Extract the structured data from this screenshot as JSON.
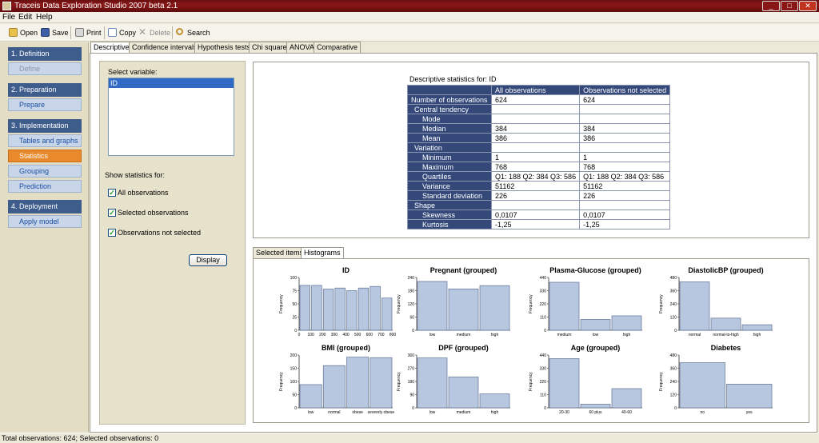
{
  "window": {
    "title": "Traceis Data Exploration Studio 2007 beta 2.1",
    "min": "_",
    "max": "□",
    "close": "✕"
  },
  "menu": [
    "File",
    "Edit",
    "Help"
  ],
  "toolbar": {
    "open": "Open",
    "save": "Save",
    "print": "Print",
    "copy": "Copy",
    "delete": "Delete",
    "search": "Search"
  },
  "sidebar": {
    "sections": [
      {
        "label": "1. Definition",
        "items": [
          {
            "label": "Define",
            "state": "disabled"
          }
        ]
      },
      {
        "label": "2. Preparation",
        "items": [
          {
            "label": "Prepare",
            "state": "normal"
          }
        ]
      },
      {
        "label": "3. Implementation",
        "items": [
          {
            "label": "Tables and graphs",
            "state": "normal"
          },
          {
            "label": "Statistics",
            "state": "active"
          },
          {
            "label": "Grouping",
            "state": "normal"
          },
          {
            "label": "Prediction",
            "state": "normal"
          }
        ]
      },
      {
        "label": "4. Deployment",
        "items": [
          {
            "label": "Apply model",
            "state": "normal"
          }
        ]
      }
    ]
  },
  "tabs": [
    "Descriptive",
    "Confidence intervals",
    "Hypothesis tests",
    "Chi square",
    "ANOVA",
    "Comparative"
  ],
  "options": {
    "select_label": "Select variable:",
    "selected_variable": "ID",
    "show_label": "Show statistics for:",
    "checks": [
      {
        "label": "All observations",
        "checked": true
      },
      {
        "label": "Selected observations",
        "checked": true
      },
      {
        "label": "Observations not selected",
        "checked": true
      }
    ],
    "display_button": "Display"
  },
  "stats": {
    "title": "Descriptive statistics for: ID",
    "columns": [
      "",
      "All observations",
      "Observations not selected"
    ],
    "rows": [
      {
        "label": "Number of observations",
        "indent": 0,
        "a": "624",
        "b": "624"
      },
      {
        "label": "Central tendency",
        "indent": 1,
        "a": "",
        "b": ""
      },
      {
        "label": "Mode",
        "indent": 2,
        "a": "",
        "b": ""
      },
      {
        "label": "Median",
        "indent": 2,
        "a": "384",
        "b": "384"
      },
      {
        "label": "Mean",
        "indent": 2,
        "a": "386",
        "b": "386"
      },
      {
        "label": "Variation",
        "indent": 1,
        "a": "",
        "b": ""
      },
      {
        "label": "Minimum",
        "indent": 2,
        "a": "1",
        "b": "1"
      },
      {
        "label": "Maximum",
        "indent": 2,
        "a": "768",
        "b": "768"
      },
      {
        "label": "Quartiles",
        "indent": 2,
        "a": "Q1: 188 Q2: 384 Q3: 586",
        "b": "Q1: 188 Q2: 384 Q3: 586"
      },
      {
        "label": "Variance",
        "indent": 2,
        "a": "51162",
        "b": "51162"
      },
      {
        "label": "Standard deviation",
        "indent": 2,
        "a": "226",
        "b": "226"
      },
      {
        "label": "Shape",
        "indent": 1,
        "a": "",
        "b": ""
      },
      {
        "label": "Skewness",
        "indent": 2,
        "a": "0,0107",
        "b": "0,0107"
      },
      {
        "label": "Kurtosis",
        "indent": 2,
        "a": "-1,25",
        "b": "-1,25"
      }
    ]
  },
  "lower_tabs": [
    "Selected items",
    "Histograms"
  ],
  "chart_data": [
    {
      "type": "bar",
      "title": "ID",
      "ylabel": "Frequency",
      "ymax": 100,
      "yticks": [
        0,
        25,
        50,
        75,
        100
      ],
      "categories": [
        "0",
        "100",
        "200",
        "300",
        "400",
        "500",
        "600",
        "700",
        "800"
      ],
      "values": [
        85,
        85,
        78,
        80,
        75,
        80,
        83,
        61
      ],
      "histogram": true
    },
    {
      "type": "bar",
      "title": "Pregnant (grouped)",
      "ylabel": "Frequency",
      "ymax": 240,
      "yticks": [
        0,
        60,
        120,
        180,
        240
      ],
      "categories": [
        "low",
        "medium",
        "high"
      ],
      "values": [
        222,
        188,
        203
      ]
    },
    {
      "type": "bar",
      "title": "Plasma-Glucose (grouped)",
      "ylabel": "Frequency",
      "ymax": 440,
      "yticks": [
        0,
        110,
        220,
        330,
        440
      ],
      "categories": [
        "medium",
        "low",
        "high"
      ],
      "values": [
        400,
        90,
        120
      ]
    },
    {
      "type": "bar",
      "title": "DiastolicBP (grouped)",
      "ylabel": "Frequency",
      "ymax": 480,
      "yticks": [
        0,
        120,
        240,
        360,
        480
      ],
      "categories": [
        "normal",
        "normal-to-high",
        "high"
      ],
      "values": [
        440,
        110,
        50
      ]
    },
    {
      "type": "bar",
      "title": "BMI (grouped)",
      "ylabel": "Frequency",
      "ymax": 200,
      "yticks": [
        0,
        50,
        100,
        150,
        200
      ],
      "categories": [
        "low",
        "normal",
        "obese",
        "severely obese"
      ],
      "values": [
        88,
        160,
        192,
        190
      ]
    },
    {
      "type": "bar",
      "title": "DPF (grouped)",
      "ylabel": "Frequency",
      "ymax": 360,
      "yticks": [
        0,
        90,
        180,
        270,
        360
      ],
      "categories": [
        "low",
        "medium",
        "high"
      ],
      "values": [
        340,
        210,
        95
      ]
    },
    {
      "type": "bar",
      "title": "Age (grouped)",
      "ylabel": "Frequency",
      "ymax": 440,
      "yticks": [
        0,
        110,
        220,
        330,
        440
      ],
      "categories": [
        "20-30",
        "60 plus",
        "40-60"
      ],
      "values": [
        410,
        30,
        160
      ]
    },
    {
      "type": "bar",
      "title": "Diabetes",
      "ylabel": "Frequency",
      "ymax": 480,
      "yticks": [
        0,
        120,
        240,
        360,
        480
      ],
      "categories": [
        "no",
        "yes"
      ],
      "values": [
        410,
        215
      ]
    }
  ],
  "status": "Total observations: 624; Selected observations: 0"
}
